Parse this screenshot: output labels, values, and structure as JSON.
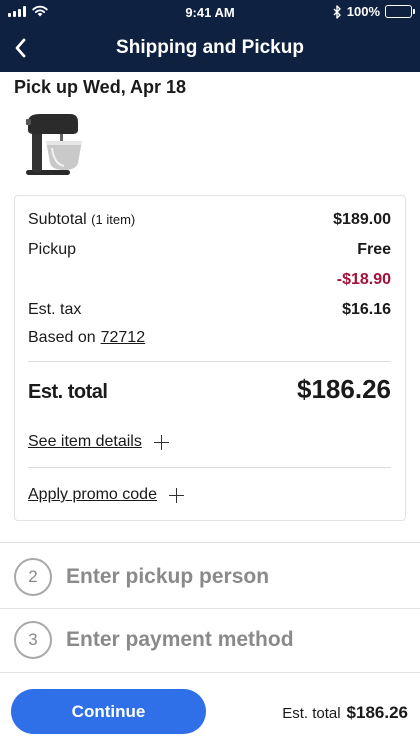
{
  "status_bar": {
    "time": "9:41 AM",
    "battery": "100%",
    "icons": [
      "signal-icon",
      "wifi-icon",
      "bluetooth-icon",
      "battery-icon"
    ]
  },
  "header": {
    "title": "Shipping and Pickup",
    "back_icon": "chevron-left-icon"
  },
  "pickup": {
    "heading": "Pick up Wed, Apr 18",
    "product_image": "stand-mixer"
  },
  "summary": {
    "subtotal_label": "Subtotal",
    "subtotal_items": "(1 item)",
    "subtotal_value": "$189.00",
    "pickup_label": "Pickup",
    "pickup_value": "Free",
    "discount_value": "-$18.90",
    "tax_label": "Est. tax",
    "tax_value": "$16.16",
    "based_on_label": "Based on",
    "zip": "72712",
    "total_label": "Est. total",
    "total_value": "$186.26",
    "item_details_link": "See item details",
    "promo_link": "Apply promo code"
  },
  "steps": [
    {
      "number": "2",
      "label": "Enter pickup person"
    },
    {
      "number": "3",
      "label": "Enter payment method"
    }
  ],
  "footer": {
    "continue_label": "Continue",
    "total_label": "Est. total",
    "total_value": "$186.26"
  },
  "colors": {
    "header_bg": "#0f2141",
    "primary_button": "#2f6fe8",
    "discount": "#a3123c"
  }
}
